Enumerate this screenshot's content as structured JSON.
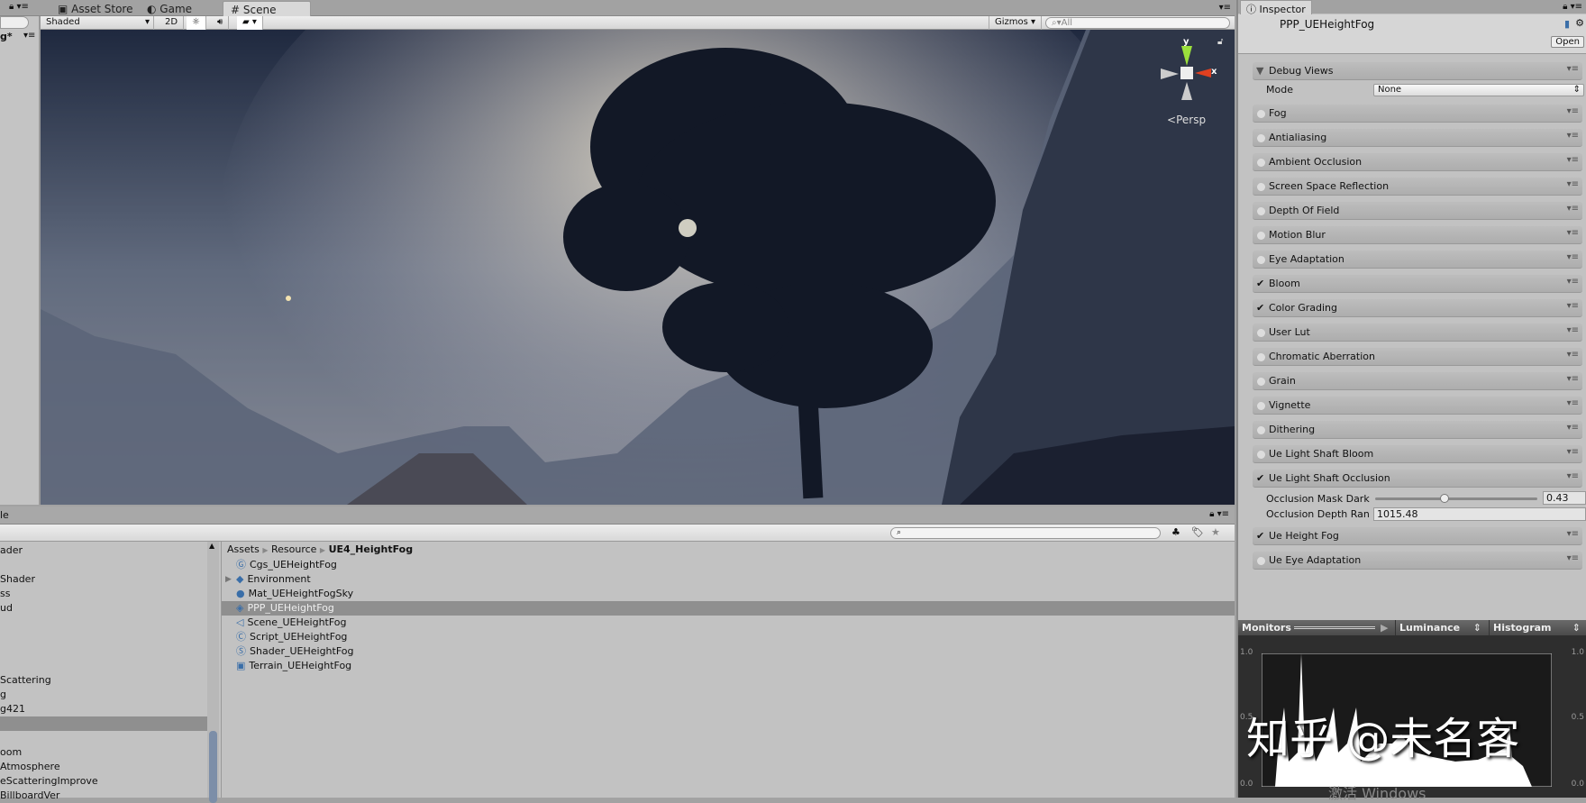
{
  "tabs": [
    {
      "label": "Asset Store",
      "icon": "store-icon"
    },
    {
      "label": "Game",
      "icon": "game-icon"
    },
    {
      "label": "Scene",
      "icon": "grid-icon"
    }
  ],
  "toolbar": {
    "shading": "Shaded",
    "mode_2d": "2D",
    "gizmos": "Gizmos",
    "search_placeholder": "All"
  },
  "left_panel": {
    "title_fragment": "g*"
  },
  "scene": {
    "projection": "Persp",
    "axis_y": "y",
    "axis_x": "x"
  },
  "inspector": {
    "tab": "Inspector",
    "asset_name": "PPP_UEHeightFog",
    "open_button": "Open",
    "debug_views": {
      "label": "Debug Views",
      "mode_label": "Mode",
      "mode_value": "None"
    },
    "components": [
      {
        "label": "Fog",
        "enabled": false
      },
      {
        "label": "Antialiasing",
        "enabled": false
      },
      {
        "label": "Ambient Occlusion",
        "enabled": false
      },
      {
        "label": "Screen Space Reflection",
        "enabled": false
      },
      {
        "label": "Depth Of Field",
        "enabled": false
      },
      {
        "label": "Motion Blur",
        "enabled": false
      },
      {
        "label": "Eye Adaptation",
        "enabled": false
      },
      {
        "label": "Bloom",
        "enabled": true
      },
      {
        "label": "Color Grading",
        "enabled": true
      },
      {
        "label": "User Lut",
        "enabled": false
      },
      {
        "label": "Chromatic Aberration",
        "enabled": false
      },
      {
        "label": "Grain",
        "enabled": false
      },
      {
        "label": "Vignette",
        "enabled": false
      },
      {
        "label": "Dithering",
        "enabled": false
      },
      {
        "label": "Ue Light Shaft Bloom",
        "enabled": false
      },
      {
        "label": "Ue Light Shaft Occlusion",
        "enabled": true
      }
    ],
    "occlusion_mask_dark": {
      "label": "Occlusion Mask Dark",
      "value": "0.43",
      "fraction": 0.43
    },
    "occlusion_depth_range": {
      "label": "Occlusion Depth Ran",
      "value": "1015.48"
    },
    "components_after": [
      {
        "label": "Ue Height Fog",
        "enabled": true
      },
      {
        "label": "Ue Eye Adaptation",
        "enabled": false
      }
    ],
    "monitors": {
      "label": "Monitors",
      "channel": "Luminance",
      "type": "Histogram",
      "y_top": "1.0",
      "y_mid": "0.5",
      "y_bottom": "0.0"
    }
  },
  "watermark": "知乎 @未名客",
  "windows_notice": "激活 Windows",
  "bottom": {
    "tab_fragment": "le",
    "breadcrumb": [
      "Assets",
      "Resource",
      "UE4_HeightFog"
    ],
    "tree_items": [
      "ader",
      "",
      "Shader",
      "ss",
      "ud",
      "",
      "",
      "",
      "",
      "Scattering",
      "g",
      "g421",
      "",
      "",
      "oom",
      "Atmosphere",
      "eScatteringImprove",
      "BillboardVer"
    ],
    "files": [
      {
        "name": "Cgs_UEHeightFog",
        "icon": "cg-icon"
      },
      {
        "name": "Environment",
        "icon": "prefab-folder-icon"
      },
      {
        "name": "Mat_UEHeightFogSky",
        "icon": "material-icon"
      },
      {
        "name": "PPP_UEHeightFog",
        "icon": "postprocess-profile-icon",
        "selected": true
      },
      {
        "name": "Scene_UEHeightFog",
        "icon": "unity-scene-icon"
      },
      {
        "name": "Script_UEHeightFog",
        "icon": "csharp-icon"
      },
      {
        "name": "Shader_UEHeightFog",
        "icon": "shader-icon"
      },
      {
        "name": "Terrain_UEHeightFog",
        "icon": "terrain-icon"
      }
    ]
  }
}
